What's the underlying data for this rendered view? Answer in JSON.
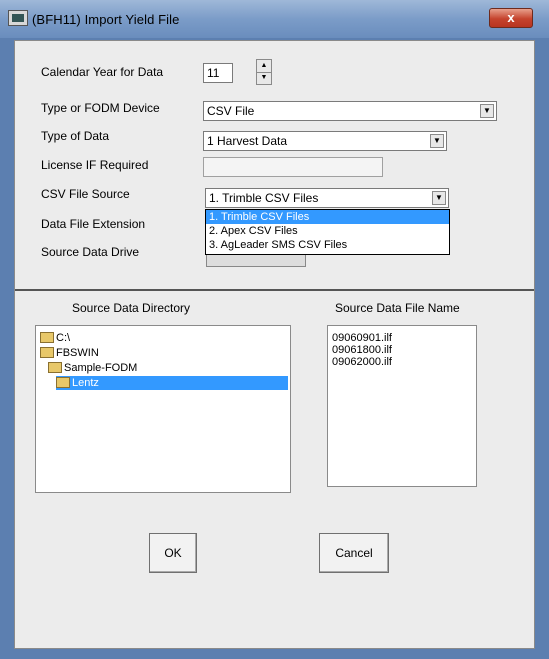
{
  "window": {
    "title": "(BFH11)  Import Yield File",
    "close_label": "x"
  },
  "form": {
    "calendar_year": {
      "label": "Calendar Year for Data",
      "value": "11"
    },
    "device": {
      "label": "Type or FODM Device",
      "value": "CSV File"
    },
    "data_type": {
      "label": "Type of Data",
      "value": "1  Harvest Data"
    },
    "license": {
      "label": "License IF Required",
      "value": ""
    },
    "csv_source": {
      "label": "CSV File Source",
      "value": "1. Trimble CSV Files",
      "options": [
        "1. Trimble CSV Files",
        "2. Apex CSV Files",
        "3. AgLeader SMS CSV Files"
      ]
    },
    "extension": {
      "label": "Data File Extension"
    },
    "drive": {
      "label": "Source Data Drive"
    }
  },
  "directory": {
    "label": "Source Data Directory",
    "items": [
      "C:\\",
      "FBSWIN",
      "Sample-FODM",
      "Lentz"
    ]
  },
  "files": {
    "label": "Source Data File Name",
    "items": [
      "09060901.ilf",
      "09061800.ilf",
      "09062000.ilf"
    ]
  },
  "buttons": {
    "ok": "OK",
    "cancel": "Cancel"
  }
}
